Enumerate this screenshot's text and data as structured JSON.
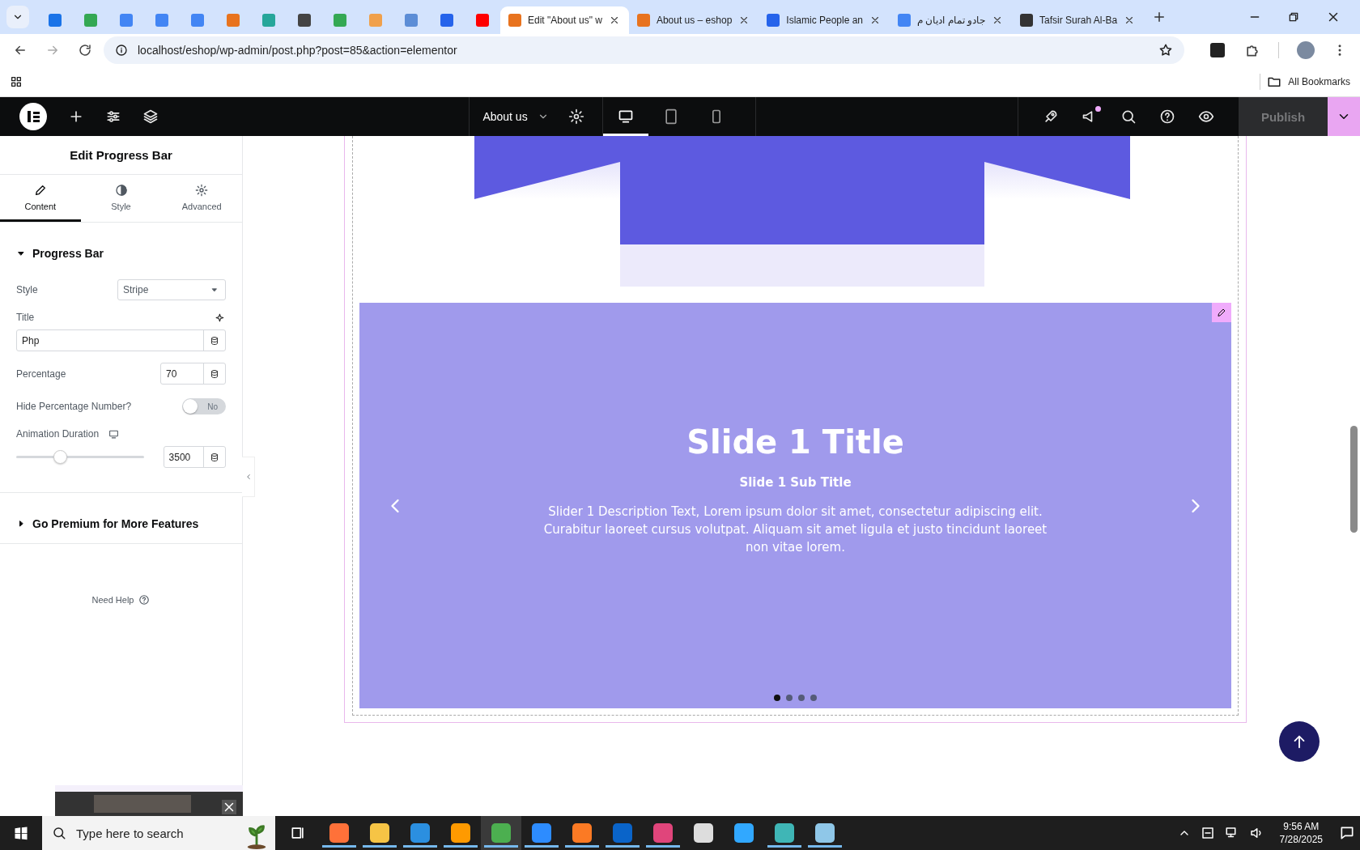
{
  "browser": {
    "tabs": [
      {
        "kind": "icon",
        "color": "#1a73e8",
        "selected": false
      },
      {
        "kind": "icon",
        "color": "#34a853",
        "selected": false
      },
      {
        "kind": "icon",
        "color": "#4285f4",
        "selected": false
      },
      {
        "kind": "icon",
        "color": "#4285f4",
        "selected": false
      },
      {
        "kind": "icon",
        "color": "#4285f4",
        "selected": false
      },
      {
        "kind": "icon",
        "color": "#e8731e",
        "selected": false
      },
      {
        "kind": "icon",
        "color": "#26a69a",
        "selected": false
      },
      {
        "kind": "icon",
        "color": "#444444",
        "selected": false
      },
      {
        "kind": "icon",
        "color": "#34a853",
        "selected": false
      },
      {
        "kind": "icon",
        "color": "#f0a04b",
        "selected": false
      },
      {
        "kind": "icon",
        "color": "#5c8dd6",
        "selected": false
      },
      {
        "kind": "icon",
        "color": "#2563eb",
        "selected": false
      },
      {
        "kind": "icon",
        "color": "#ff0000",
        "selected": false
      },
      {
        "kind": "text",
        "title": "Edit \"About us\" w",
        "color": "#e8731e",
        "selected": true
      },
      {
        "kind": "text",
        "title": "About us – eshop",
        "color": "#e8731e",
        "selected": false
      },
      {
        "kind": "text",
        "title": "Islamic People an",
        "color": "#2563eb",
        "selected": false
      },
      {
        "kind": "text",
        "title": "جادو تمام ادیان م",
        "color": "#4285f4",
        "selected": false
      },
      {
        "kind": "text",
        "title": "Tafsir Surah Al-Ba",
        "color": "#333333",
        "selected": false
      }
    ],
    "address": "localhost/eshop/wp-admin/post.php?post=85&action=elementor",
    "all_bookmarks": "All Bookmarks"
  },
  "editor_bar": {
    "page_title": "About us",
    "devices": [
      {
        "kind": "desktop",
        "selected": true
      },
      {
        "kind": "tablet",
        "selected": false
      },
      {
        "kind": "mobile",
        "selected": false
      }
    ],
    "has_notification": true,
    "publish": {
      "label": "Publish",
      "disabled": true
    }
  },
  "panel": {
    "title": "Edit Progress Bar",
    "tabs": [
      {
        "label": "Content",
        "kind": "pencil",
        "selected": true
      },
      {
        "label": "Style",
        "kind": "contrast",
        "selected": false
      },
      {
        "label": "Advanced",
        "kind": "gear",
        "selected": false
      }
    ],
    "sections": [
      {
        "title": "Progress Bar",
        "expanded": true,
        "controls": [
          {
            "kind": "select",
            "label": "Style",
            "value": "Stripe"
          },
          {
            "kind": "text",
            "label": "Title",
            "value": "Php"
          },
          {
            "kind": "number",
            "label": "Percentage",
            "value": "70"
          },
          {
            "kind": "switch",
            "label": "Hide Percentage Number?",
            "on": false,
            "state_text": "No"
          },
          {
            "kind": "slider",
            "label": "Animation Duration",
            "level": 0.34,
            "value": "3500"
          }
        ]
      },
      {
        "title": "Go Premium for More Features",
        "expanded": false
      }
    ],
    "help": "Need Help"
  },
  "slide": {
    "title": "Slide 1 Title",
    "subtitle": "Slide 1 Sub Title",
    "description": "Slider 1 Description Text, Lorem ipsum dolor sit amet, consectetur adipiscing elit. Curabitur laoreet cursus volutpat. Aliquam sit amet ligula et justo tincidunt laoreet non vitae lorem.",
    "dots": [
      {
        "selected": true
      },
      {
        "selected": false
      },
      {
        "selected": false
      },
      {
        "selected": false
      }
    ]
  },
  "taskbar": {
    "search_placeholder": "Type here to search",
    "apps": [
      {
        "color": "#ff7139",
        "running": true,
        "selected": false
      },
      {
        "color": "#f6c445",
        "running": true,
        "selected": false
      },
      {
        "color": "#2b8fe0",
        "running": true,
        "selected": false
      },
      {
        "color": "#ff9a00",
        "running": true,
        "selected": false
      },
      {
        "color": "#4caf50",
        "running": true,
        "selected": true
      },
      {
        "color": "#2d8cff",
        "running": true,
        "selected": false
      },
      {
        "color": "#fb7a24",
        "running": true,
        "selected": false
      },
      {
        "color": "#0a64c9",
        "running": true,
        "selected": false
      },
      {
        "color": "#e0457b",
        "running": true,
        "selected": false
      },
      {
        "color": "#dddddd",
        "running": false,
        "selected": false
      },
      {
        "color": "#31a8ff",
        "running": false,
        "selected": false
      },
      {
        "color": "#3fb6b6",
        "running": true,
        "selected": false
      },
      {
        "color": "#8fc7e8",
        "running": true,
        "selected": false
      }
    ],
    "time": "9:56 AM",
    "date": "7/28/2025"
  }
}
